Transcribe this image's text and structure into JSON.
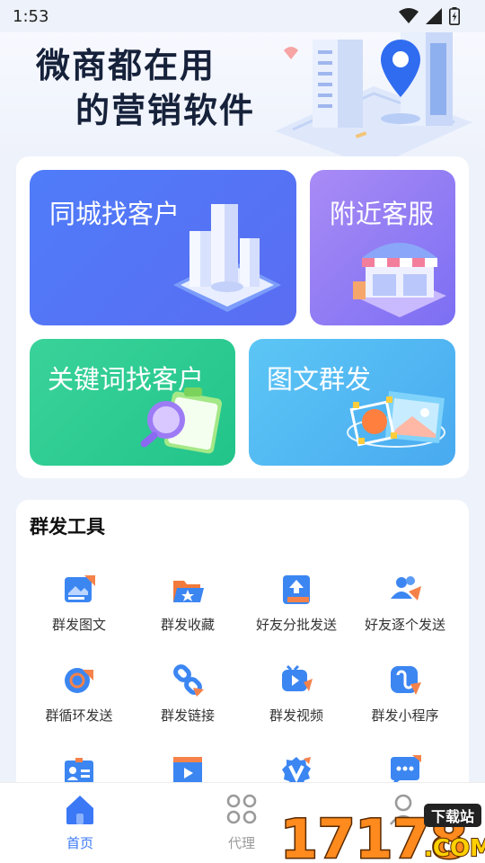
{
  "status_bar": {
    "time": "1:53"
  },
  "hero": {
    "line1": "微商都在用",
    "line2": "的营销软件"
  },
  "feature_tiles": [
    {
      "label": "同城找客户",
      "color": "#4f7cf9"
    },
    {
      "label": "附近客服",
      "color": "#8c7bf4"
    },
    {
      "label": "关键词找客户",
      "color": "#2dcb90"
    },
    {
      "label": "图文群发",
      "color": "#54b8f3"
    }
  ],
  "tools": {
    "title": "群发工具",
    "items": [
      {
        "label": "群发图文",
        "icon": "image-text-icon"
      },
      {
        "label": "群发收藏",
        "icon": "folder-star-icon"
      },
      {
        "label": "好友分批发送",
        "icon": "upload-box-icon"
      },
      {
        "label": "好友逐个发送",
        "icon": "users-send-icon"
      },
      {
        "label": "群循环发送",
        "icon": "loop-send-icon"
      },
      {
        "label": "群发链接",
        "icon": "link-icon"
      },
      {
        "label": "群发视频",
        "icon": "video-icon"
      },
      {
        "label": "群发小程序",
        "icon": "mini-program-icon"
      },
      {
        "label": "",
        "icon": "id-card-icon"
      },
      {
        "label": "",
        "icon": "film-icon"
      },
      {
        "label": "",
        "icon": "v-badge-icon"
      },
      {
        "label": "",
        "icon": "chat-bubble-icon"
      }
    ]
  },
  "nav": {
    "items": [
      {
        "label": "首页",
        "icon": "home-icon",
        "active": true
      },
      {
        "label": "代理",
        "icon": "grid-clover-icon",
        "active": false
      },
      {
        "label": "",
        "icon": "profile-icon",
        "active": false
      }
    ],
    "active_color": "#3b78f6",
    "inactive_color": "#9a9a9a"
  },
  "watermark": {
    "text": "17178",
    "domain": ".COM",
    "tag": "下载站"
  }
}
